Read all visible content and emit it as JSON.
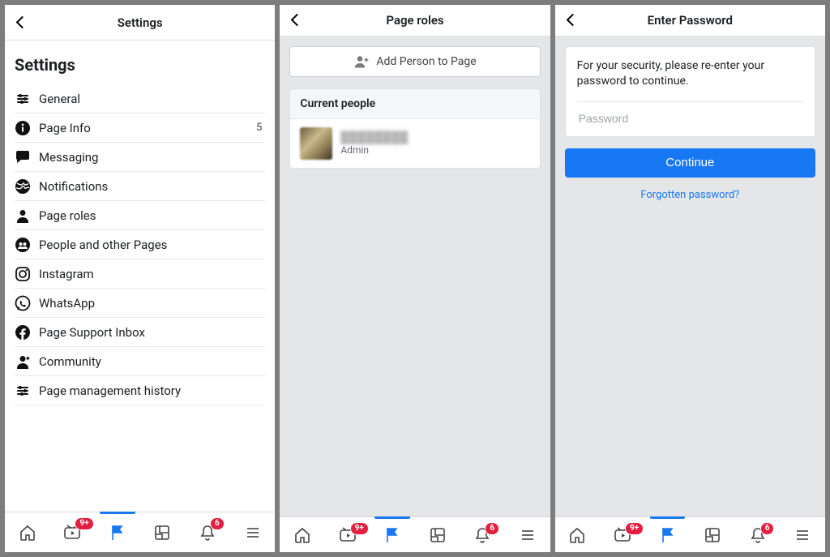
{
  "panel1": {
    "header_title": "Settings",
    "section_title": "Settings",
    "items": [
      {
        "icon": "sliders",
        "label": "General"
      },
      {
        "icon": "info",
        "label": "Page Info",
        "count": "5"
      },
      {
        "icon": "chat",
        "label": "Messaging"
      },
      {
        "icon": "globe",
        "label": "Notifications"
      },
      {
        "icon": "person",
        "label": "Page roles"
      },
      {
        "icon": "people",
        "label": "People and other Pages"
      },
      {
        "icon": "instagram",
        "label": "Instagram"
      },
      {
        "icon": "whatsapp",
        "label": "WhatsApp"
      },
      {
        "icon": "facebook",
        "label": "Page Support Inbox"
      },
      {
        "icon": "community",
        "label": "Community"
      },
      {
        "icon": "sliders",
        "label": "Page management history"
      }
    ]
  },
  "panel2": {
    "header_title": "Page roles",
    "add_button_label": "Add Person to Page",
    "list_header": "Current people",
    "person": {
      "name": "████████",
      "role": "Admin"
    }
  },
  "panel3": {
    "header_title": "Enter Password",
    "message": "For your security, please re-enter your password to continue.",
    "placeholder": "Password",
    "continue_label": "Continue",
    "forgot_label": "Forgotten password?"
  },
  "tabs": {
    "watch_badge": "9+",
    "bell_badge": "6"
  }
}
